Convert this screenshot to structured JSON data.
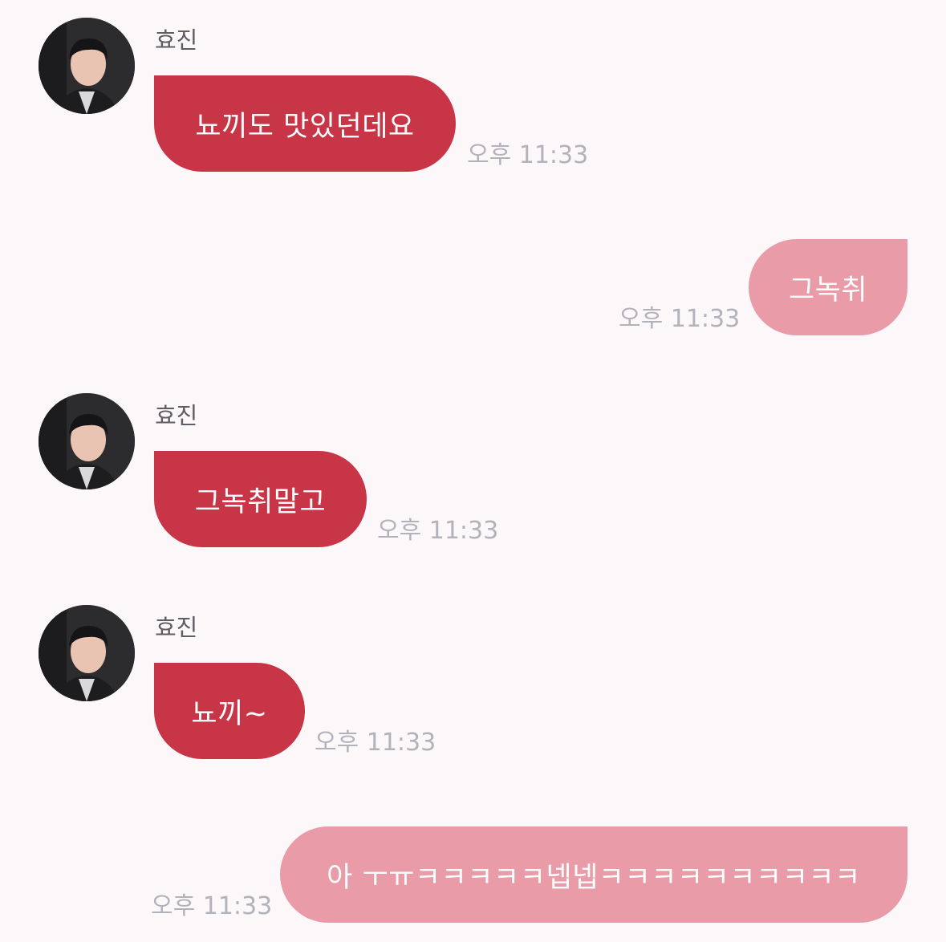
{
  "messages": [
    {
      "direction": "incoming",
      "sender": "효진",
      "text": "뇨끼도 맛있던데요",
      "time": "오후 11:33"
    },
    {
      "direction": "outgoing",
      "text": "그녹취",
      "time": "오후 11:33"
    },
    {
      "direction": "incoming",
      "sender": "효진",
      "text": "그녹취말고",
      "time": "오후 11:33"
    },
    {
      "direction": "incoming",
      "sender": "효진",
      "text": "뇨끼~",
      "time": "오후 11:33"
    },
    {
      "direction": "outgoing",
      "text": "아 ㅜㅠㅋㅋㅋㅋㅋ넵넵ㅋㅋㅋㅋㅋㅋㅋㅋㅋㅋ",
      "time": "오후 11:33"
    }
  ],
  "colors": {
    "background": "#fcf7f9",
    "incoming_bubble": "#c73546",
    "outgoing_bubble": "#e99ba8",
    "bubble_text": "#ffffff",
    "timestamp": "#b2b3ba",
    "sender_name": "#5d5d62"
  },
  "icons": {
    "avatar": "profile-photo-avatar"
  }
}
